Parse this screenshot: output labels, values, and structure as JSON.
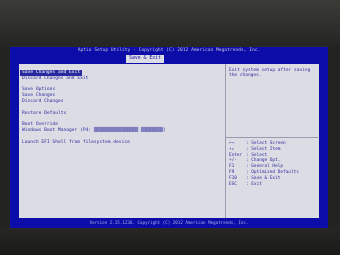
{
  "bios": {
    "title": "Aptio Setup Utility - Copyright (C) 2012 American Megatrends, Inc.",
    "active_tab": "Save & Exit",
    "menu_items": [
      {
        "label": "Save Changes and Exit",
        "selected": true
      },
      {
        "label": "Discard Changes and Exit",
        "selected": false
      },
      {
        "label": "Save Options",
        "selected": false
      },
      {
        "label": "Save Changes",
        "selected": false
      },
      {
        "label": "Discard Changes",
        "selected": false
      },
      {
        "label": "Restore Defaults",
        "selected": false
      },
      {
        "label": "Boot Override",
        "selected": false
      },
      {
        "label": "Windows Boot Manager (P4: ▒▒▒▒▒▒▒▒▒▒▒▒▒▒▒▒ ▒▒▒▒▒▒▒▒)",
        "selected": false
      },
      {
        "label": "Launch EFI Shell from filesystem device",
        "selected": false
      }
    ],
    "help_text": "Exit system setup after saving the changes.",
    "keys": [
      {
        "key": "←→",
        "desc": ": Select Screen"
      },
      {
        "key": "↑↓",
        "desc": ": Select Item"
      },
      {
        "key": "Enter",
        "desc": ": Select"
      },
      {
        "key": "+/-",
        "desc": ": Change Opt."
      },
      {
        "key": "F1",
        "desc": ": General Help"
      },
      {
        "key": "F9",
        "desc": ": Optimized Defaults"
      },
      {
        "key": "F10",
        "desc": ": Save & Exit"
      },
      {
        "key": "ESC",
        "desc": ": Exit"
      }
    ],
    "footer": "Version 2.15.1236. Copyright (C) 2012 American Megatrends, Inc."
  }
}
